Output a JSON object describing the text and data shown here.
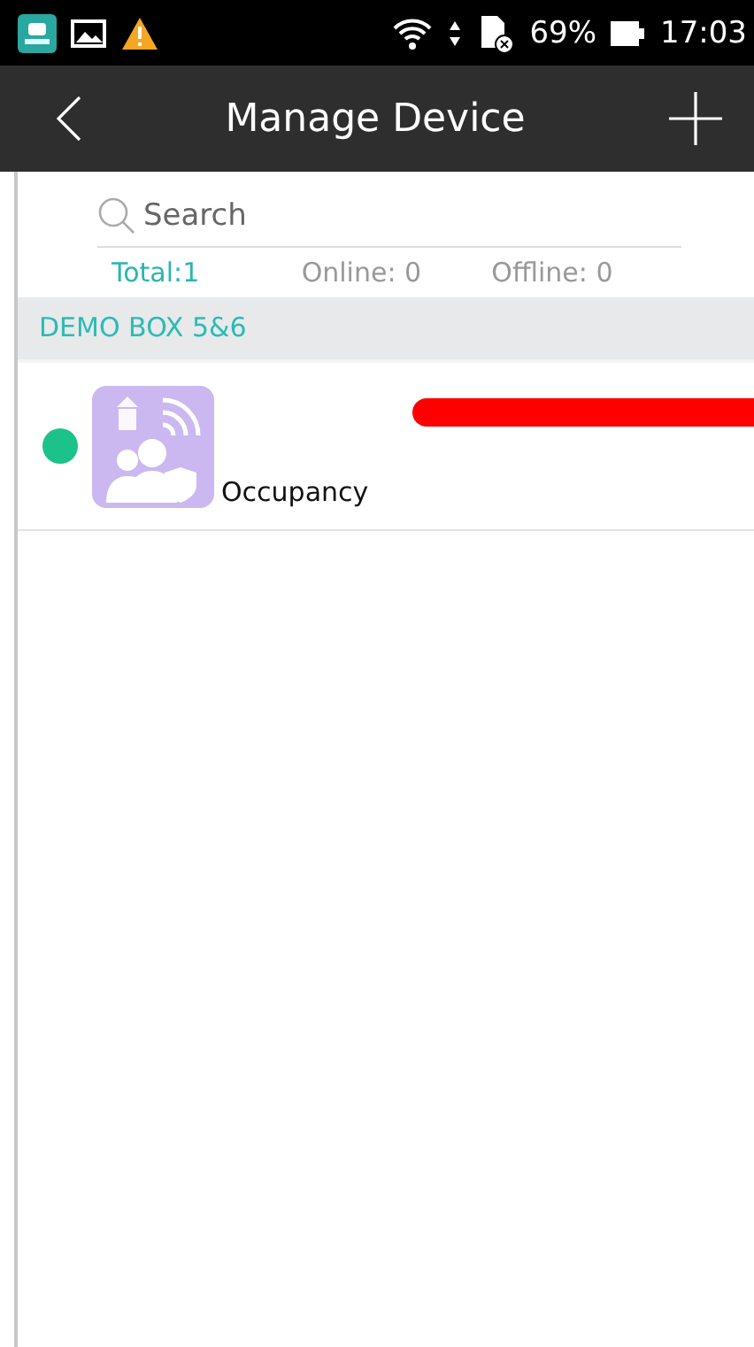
{
  "status_bar": {
    "battery": "69%",
    "time": "17:03"
  },
  "header": {
    "title": "Manage Device"
  },
  "search": {
    "placeholder": "Search"
  },
  "stats": [
    {
      "label": "Total:",
      "value": "1",
      "selected": true
    },
    {
      "label": "Online:",
      "value": "0",
      "selected": false
    },
    {
      "label": "Offline:",
      "value": "0",
      "selected": false
    }
  ],
  "groups": [
    {
      "title": "DEMO BOX 5&6",
      "devices": [
        {
          "type": "Occupancy",
          "online": true
        }
      ]
    }
  ]
}
